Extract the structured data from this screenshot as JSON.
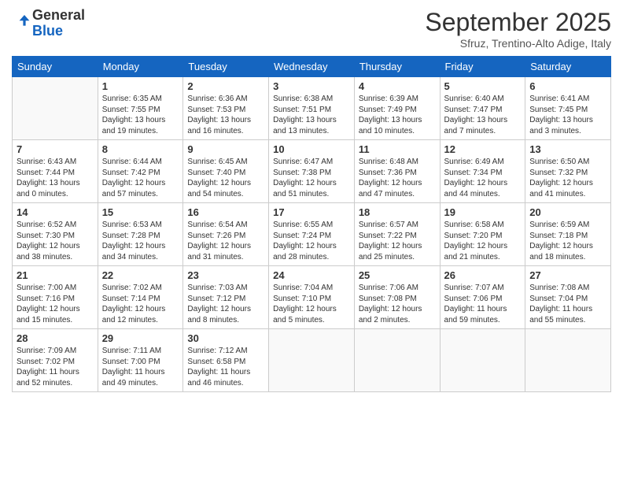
{
  "header": {
    "logo_line1": "General",
    "logo_line2": "Blue",
    "month": "September 2025",
    "location": "Sfruz, Trentino-Alto Adige, Italy"
  },
  "days_of_week": [
    "Sunday",
    "Monday",
    "Tuesday",
    "Wednesday",
    "Thursday",
    "Friday",
    "Saturday"
  ],
  "weeks": [
    [
      {
        "day": "",
        "content": ""
      },
      {
        "day": "1",
        "content": "Sunrise: 6:35 AM\nSunset: 7:55 PM\nDaylight: 13 hours\nand 19 minutes."
      },
      {
        "day": "2",
        "content": "Sunrise: 6:36 AM\nSunset: 7:53 PM\nDaylight: 13 hours\nand 16 minutes."
      },
      {
        "day": "3",
        "content": "Sunrise: 6:38 AM\nSunset: 7:51 PM\nDaylight: 13 hours\nand 13 minutes."
      },
      {
        "day": "4",
        "content": "Sunrise: 6:39 AM\nSunset: 7:49 PM\nDaylight: 13 hours\nand 10 minutes."
      },
      {
        "day": "5",
        "content": "Sunrise: 6:40 AM\nSunset: 7:47 PM\nDaylight: 13 hours\nand 7 minutes."
      },
      {
        "day": "6",
        "content": "Sunrise: 6:41 AM\nSunset: 7:45 PM\nDaylight: 13 hours\nand 3 minutes."
      }
    ],
    [
      {
        "day": "7",
        "content": "Sunrise: 6:43 AM\nSunset: 7:44 PM\nDaylight: 13 hours\nand 0 minutes."
      },
      {
        "day": "8",
        "content": "Sunrise: 6:44 AM\nSunset: 7:42 PM\nDaylight: 12 hours\nand 57 minutes."
      },
      {
        "day": "9",
        "content": "Sunrise: 6:45 AM\nSunset: 7:40 PM\nDaylight: 12 hours\nand 54 minutes."
      },
      {
        "day": "10",
        "content": "Sunrise: 6:47 AM\nSunset: 7:38 PM\nDaylight: 12 hours\nand 51 minutes."
      },
      {
        "day": "11",
        "content": "Sunrise: 6:48 AM\nSunset: 7:36 PM\nDaylight: 12 hours\nand 47 minutes."
      },
      {
        "day": "12",
        "content": "Sunrise: 6:49 AM\nSunset: 7:34 PM\nDaylight: 12 hours\nand 44 minutes."
      },
      {
        "day": "13",
        "content": "Sunrise: 6:50 AM\nSunset: 7:32 PM\nDaylight: 12 hours\nand 41 minutes."
      }
    ],
    [
      {
        "day": "14",
        "content": "Sunrise: 6:52 AM\nSunset: 7:30 PM\nDaylight: 12 hours\nand 38 minutes."
      },
      {
        "day": "15",
        "content": "Sunrise: 6:53 AM\nSunset: 7:28 PM\nDaylight: 12 hours\nand 34 minutes."
      },
      {
        "day": "16",
        "content": "Sunrise: 6:54 AM\nSunset: 7:26 PM\nDaylight: 12 hours\nand 31 minutes."
      },
      {
        "day": "17",
        "content": "Sunrise: 6:55 AM\nSunset: 7:24 PM\nDaylight: 12 hours\nand 28 minutes."
      },
      {
        "day": "18",
        "content": "Sunrise: 6:57 AM\nSunset: 7:22 PM\nDaylight: 12 hours\nand 25 minutes."
      },
      {
        "day": "19",
        "content": "Sunrise: 6:58 AM\nSunset: 7:20 PM\nDaylight: 12 hours\nand 21 minutes."
      },
      {
        "day": "20",
        "content": "Sunrise: 6:59 AM\nSunset: 7:18 PM\nDaylight: 12 hours\nand 18 minutes."
      }
    ],
    [
      {
        "day": "21",
        "content": "Sunrise: 7:00 AM\nSunset: 7:16 PM\nDaylight: 12 hours\nand 15 minutes."
      },
      {
        "day": "22",
        "content": "Sunrise: 7:02 AM\nSunset: 7:14 PM\nDaylight: 12 hours\nand 12 minutes."
      },
      {
        "day": "23",
        "content": "Sunrise: 7:03 AM\nSunset: 7:12 PM\nDaylight: 12 hours\nand 8 minutes."
      },
      {
        "day": "24",
        "content": "Sunrise: 7:04 AM\nSunset: 7:10 PM\nDaylight: 12 hours\nand 5 minutes."
      },
      {
        "day": "25",
        "content": "Sunrise: 7:06 AM\nSunset: 7:08 PM\nDaylight: 12 hours\nand 2 minutes."
      },
      {
        "day": "26",
        "content": "Sunrise: 7:07 AM\nSunset: 7:06 PM\nDaylight: 11 hours\nand 59 minutes."
      },
      {
        "day": "27",
        "content": "Sunrise: 7:08 AM\nSunset: 7:04 PM\nDaylight: 11 hours\nand 55 minutes."
      }
    ],
    [
      {
        "day": "28",
        "content": "Sunrise: 7:09 AM\nSunset: 7:02 PM\nDaylight: 11 hours\nand 52 minutes."
      },
      {
        "day": "29",
        "content": "Sunrise: 7:11 AM\nSunset: 7:00 PM\nDaylight: 11 hours\nand 49 minutes."
      },
      {
        "day": "30",
        "content": "Sunrise: 7:12 AM\nSunset: 6:58 PM\nDaylight: 11 hours\nand 46 minutes."
      },
      {
        "day": "",
        "content": ""
      },
      {
        "day": "",
        "content": ""
      },
      {
        "day": "",
        "content": ""
      },
      {
        "day": "",
        "content": ""
      }
    ]
  ]
}
